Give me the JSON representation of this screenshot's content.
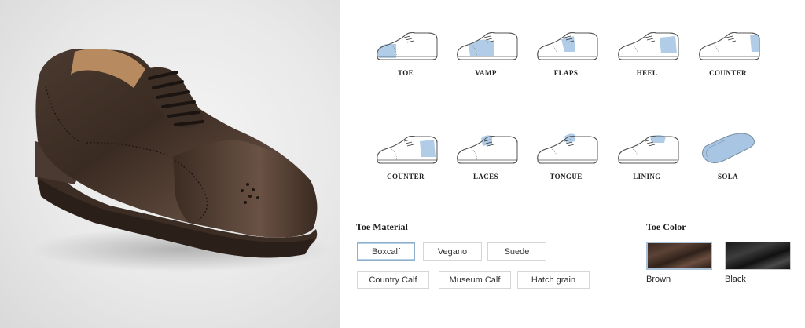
{
  "parts": [
    {
      "label": "TOE"
    },
    {
      "label": "VAMP"
    },
    {
      "label": "FLAPS"
    },
    {
      "label": "HEEL"
    },
    {
      "label": "COUNTER"
    },
    {
      "label": "COUNTER"
    },
    {
      "label": "LACES"
    },
    {
      "label": "TONGUE"
    },
    {
      "label": "LINING"
    },
    {
      "label": "SOLA"
    }
  ],
  "material": {
    "title": "Toe Material",
    "options": [
      "Boxcalf",
      "Vegano",
      "Suede",
      "Country Calf",
      "Museum Calf",
      "Hatch grain"
    ],
    "selected": "Boxcalf"
  },
  "color": {
    "title": "Toe Color",
    "swatches": [
      {
        "label": "Brown",
        "hex": "#3f2d24"
      },
      {
        "label": "Black",
        "hex": "#1a1a1a"
      }
    ],
    "selected": "Brown"
  },
  "theme": {
    "highlight": "#a8c6e4",
    "selected_border": "#8fb0cc"
  }
}
